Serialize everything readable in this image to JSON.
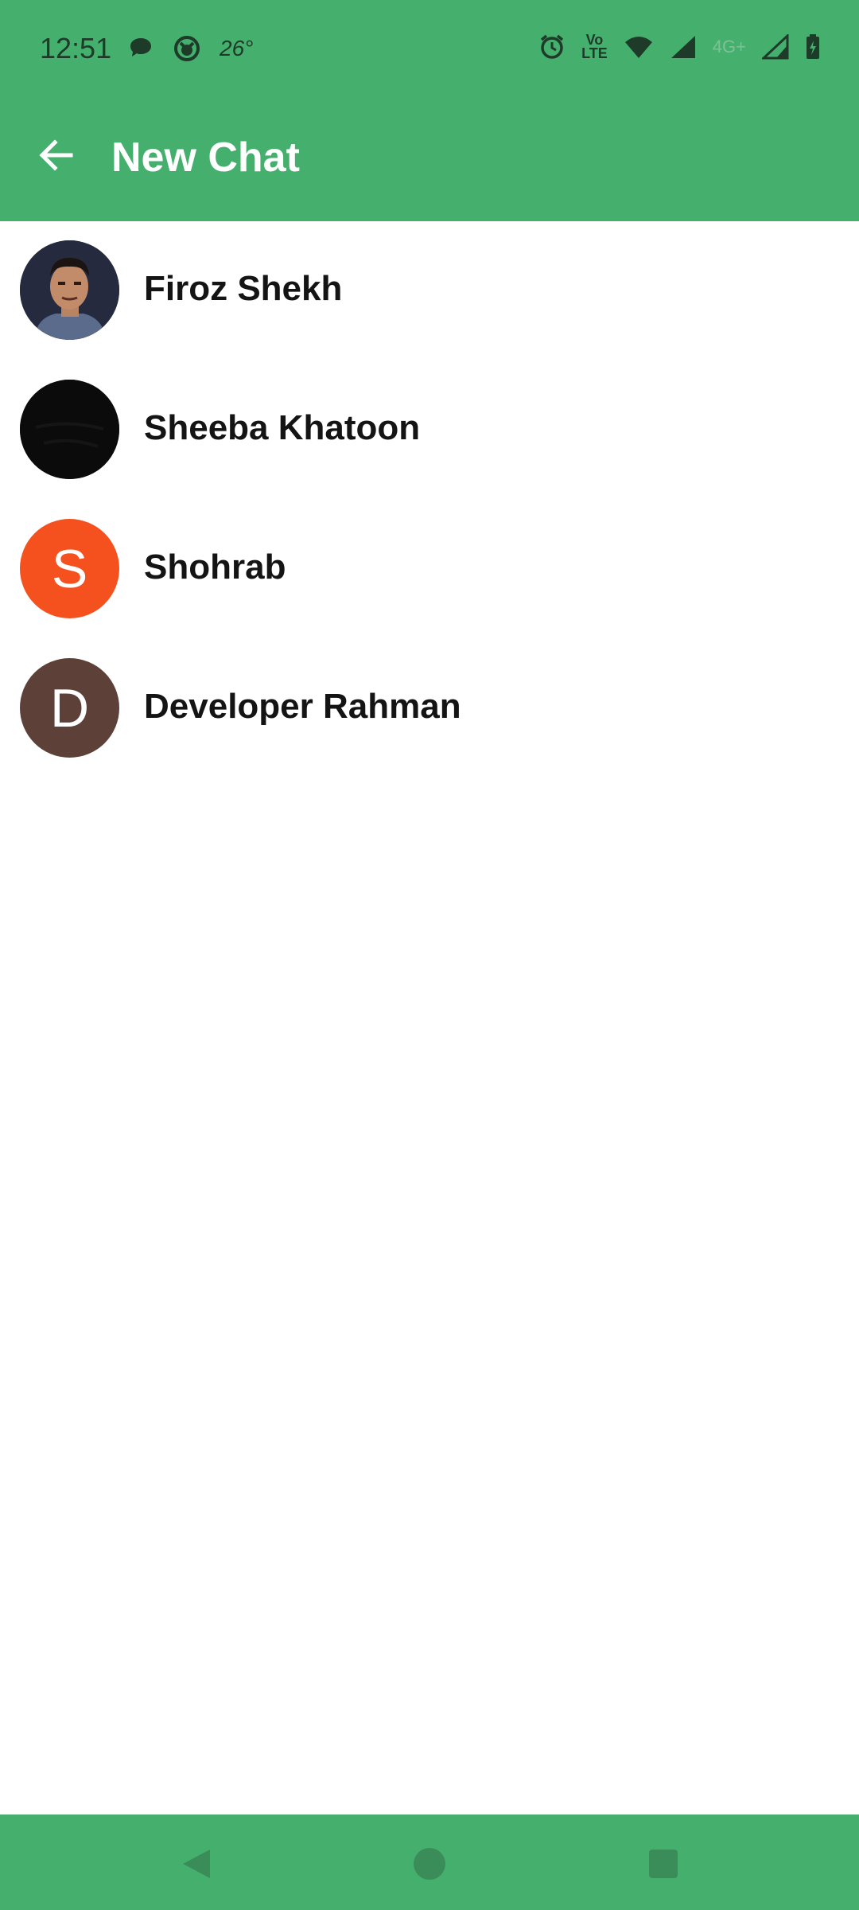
{
  "status_bar": {
    "time": "12:51",
    "temperature": "26°",
    "network_label": "Vo\nLTE",
    "network_4g": "4G+"
  },
  "app_bar": {
    "title": "New Chat",
    "back_icon": "arrow-left-icon"
  },
  "contacts": [
    {
      "name": "Firoz Shekh",
      "avatar_type": "photo",
      "avatar_color": "#2a2f45"
    },
    {
      "name": "Sheeba Khatoon",
      "avatar_type": "photo",
      "avatar_color": "#0b0b0b"
    },
    {
      "name": "Shohrab",
      "avatar_type": "letter",
      "avatar_letter": "S",
      "avatar_color": "#f4511e"
    },
    {
      "name": "Developer Rahman",
      "avatar_type": "letter",
      "avatar_letter": "D",
      "avatar_color": "#5d4037"
    }
  ],
  "colors": {
    "primary": "#45b06d",
    "text": "#141414"
  },
  "nav_bar": {
    "back_icon": "triangle-back-icon",
    "home_icon": "circle-home-icon",
    "recent_icon": "square-recents-icon"
  }
}
